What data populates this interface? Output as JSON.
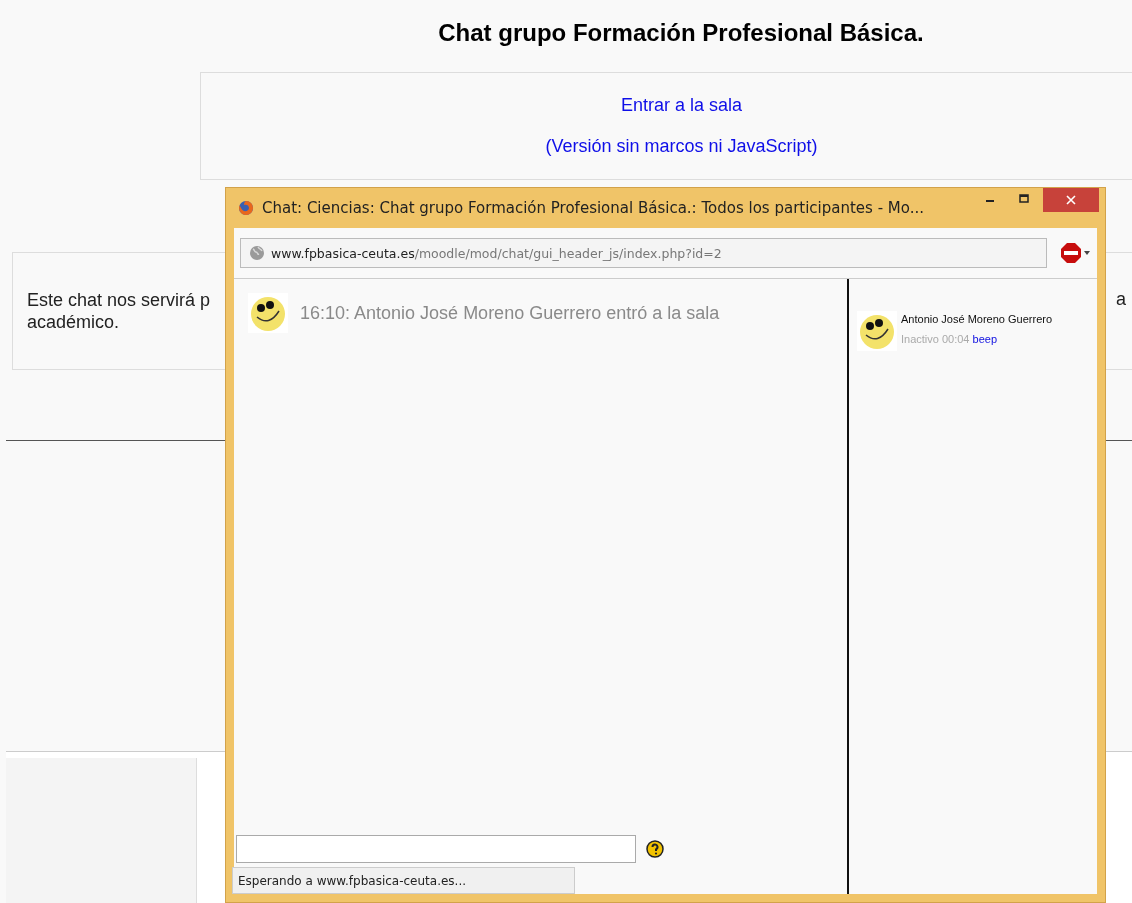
{
  "page": {
    "title": "Chat grupo Formación Profesional Básica.",
    "links": [
      "Entrar a la sala",
      "(Versión sin marcos ni JavaScript)"
    ],
    "description_lines": [
      "Este chat nos servirá p",
      "académico."
    ],
    "description_right": "a"
  },
  "popup": {
    "title": "Chat: Ciencias: Chat grupo Formación Profesional Básica.: Todos los participantes - Mo...",
    "url_host": "www.fpbasica-ceuta.es",
    "url_path": "/moodle/mod/chat/gui_header_js/index.php?id=2",
    "messages": [
      {
        "text": "16:10: Antonio José Moreno Guerrero entró a la sala"
      }
    ],
    "users": [
      {
        "name": "Antonio José Moreno Guerrero",
        "status": "Inactivo 00:04",
        "action": "beep"
      }
    ],
    "status_text": "Esperando a www.fpbasica-ceuta.es..."
  }
}
